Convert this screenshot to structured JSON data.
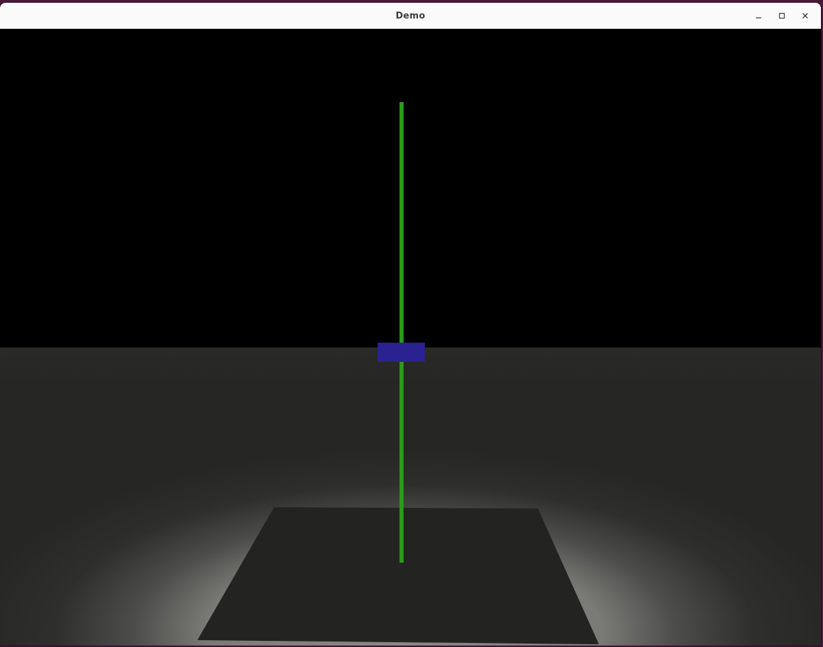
{
  "window": {
    "title": "Demo",
    "controls": {
      "minimize_icon": "minimize-icon",
      "maximize_icon": "maximize-icon",
      "close_icon": "close-icon"
    }
  },
  "scene": {
    "sky_color": "#000000",
    "floor_color": "#262625",
    "floor_light_color": "#6a6a66",
    "platform_color": "#232321",
    "pole_color": "#2a9a1c",
    "cart_color": "#2a2290"
  }
}
